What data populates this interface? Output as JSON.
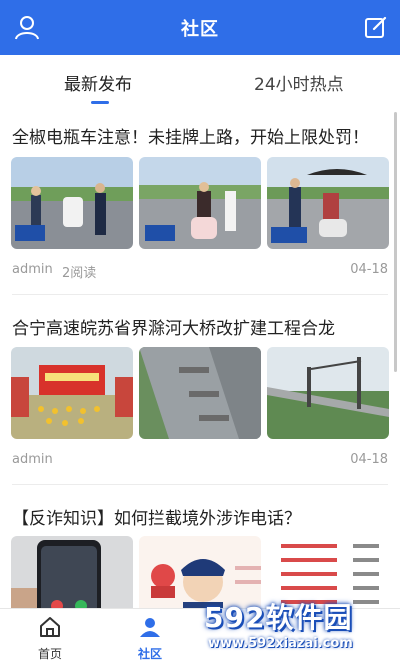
{
  "header": {
    "title": "社区",
    "left_icon": "user-icon",
    "right_icon": "edit-icon",
    "color": "#2f6ee8"
  },
  "tabs": [
    {
      "label": "最新发布",
      "active": true
    },
    {
      "label": "24小时热点",
      "active": false
    }
  ],
  "posts": [
    {
      "title": "全椒电瓶车注意！未挂牌上路，开始上限处罚！",
      "author": "admin",
      "reads": "2阅读",
      "date": "04-18"
    },
    {
      "title": "合宁高速皖苏省界滁河大桥改扩建工程合龙",
      "author": "admin",
      "reads": "",
      "date": "04-18"
    },
    {
      "title": "【反诈知识】如何拦截境外涉诈电话？",
      "author": "",
      "reads": "",
      "date": ""
    }
  ],
  "bottom_nav": [
    {
      "label": "首页",
      "icon": "home-icon",
      "active": false
    },
    {
      "label": "社区",
      "icon": "community-icon",
      "active": true
    }
  ],
  "watermark": {
    "logo": "592软件园",
    "url": "www.592xiazai.com"
  }
}
